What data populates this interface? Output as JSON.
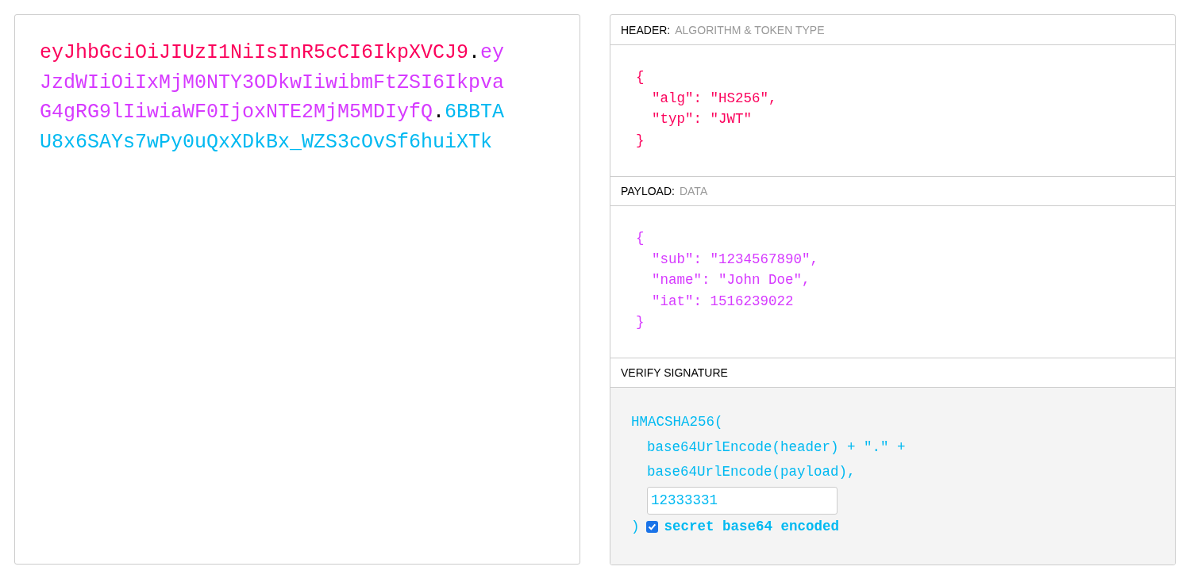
{
  "encoded": {
    "segments": [
      {
        "kind": "header",
        "text": "eyJhbGciOiJIUzI1NiIsInR5cCI6IkpXVCJ9"
      },
      {
        "kind": "dot",
        "text": "."
      },
      {
        "kind": "payload",
        "text": "eyJzdWIiOiIxMjM0NTY3ODkwIiwibmFtZSI6IkpvaG4gRG9lIiwiaWF0IjoxNTE2MjM5MDIyfQ"
      },
      {
        "kind": "dot",
        "text": "."
      },
      {
        "kind": "signature",
        "text": "6BBTAU8x6SAYs7wPy0uQxXDkBx_WZS3cOvSf6huiXTk"
      }
    ]
  },
  "decoded": [
    {
      "kind": "header",
      "title": "HEADER:",
      "subtitle": "ALGORITHM & TOKEN TYPE",
      "open": "{",
      "entries": [
        "\"alg\": \"HS256\",",
        "\"typ\": \"JWT\""
      ],
      "close": "}"
    },
    {
      "kind": "payload",
      "title": "PAYLOAD:",
      "subtitle": "DATA",
      "open": "{",
      "entries": [
        "\"sub\": \"1234567890\",",
        "\"name\": \"John Doe\",",
        "\"iat\": 1516239022"
      ],
      "close": "}"
    },
    {
      "kind": "signature",
      "title": "VERIFY SIGNATURE",
      "call": "HMACSHA256(",
      "args": [
        "base64UrlEncode(header) + \".\" +",
        "base64UrlEncode(payload),"
      ],
      "secret": "12333331",
      "close": ")",
      "base64_checked": true,
      "checkbox_label": "secret base64 encoded"
    }
  ]
}
